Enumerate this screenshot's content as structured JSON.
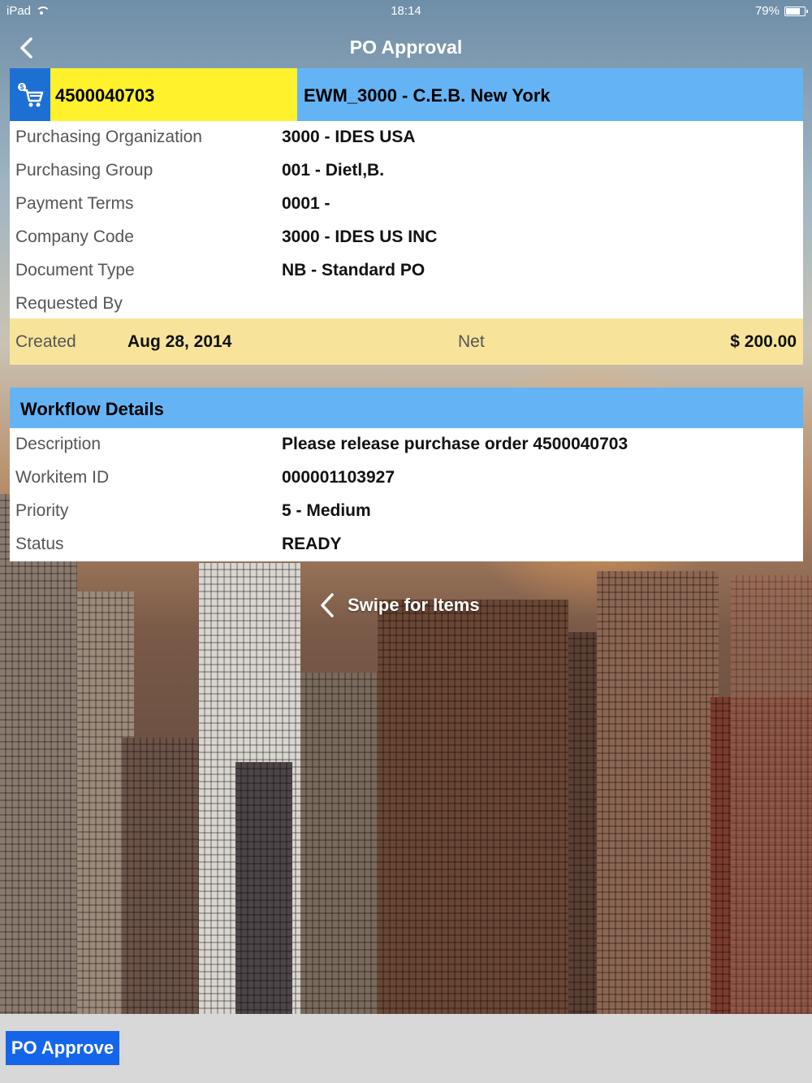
{
  "status_bar": {
    "device": "iPad",
    "time": "18:14",
    "battery_percent": "79%",
    "battery_level": 0.79
  },
  "nav": {
    "title": "PO Approval",
    "back_icon": "chevron-left-icon"
  },
  "header": {
    "icon": "shopping-cart-icon",
    "po_number": "4500040703",
    "vendor": "EWM_3000 - C.E.B. New York"
  },
  "details": [
    {
      "label": "Purchasing Organization",
      "value": "3000 - IDES USA"
    },
    {
      "label": "Purchasing Group",
      "value": "001 - Dietl,B."
    },
    {
      "label": "Payment Terms",
      "value": "0001 -"
    },
    {
      "label": "Company Code",
      "value": "3000 - IDES US INC"
    },
    {
      "label": "Document Type",
      "value": "NB - Standard PO"
    },
    {
      "label": "Requested By",
      "value": ""
    }
  ],
  "totals": {
    "created_label": "Created",
    "created_value": "Aug 28, 2014",
    "net_label": "Net",
    "net_value": "$ 200.00"
  },
  "workflow": {
    "title": "Workflow Details",
    "rows": [
      {
        "label": "Description",
        "value": "Please release purchase order 4500040703"
      },
      {
        "label": "Workitem ID",
        "value": "000001103927"
      },
      {
        "label": "Priority",
        "value": "5 - Medium"
      },
      {
        "label": "Status",
        "value": "READY"
      }
    ]
  },
  "swipe_hint": "Swipe for Items",
  "footer": {
    "approve_label": "PO Approve"
  },
  "colors": {
    "header_blue": "#64b4f5",
    "po_yellow": "#fff12c",
    "totals_yellow": "#f7e49a",
    "button_blue": "#1565ea"
  }
}
